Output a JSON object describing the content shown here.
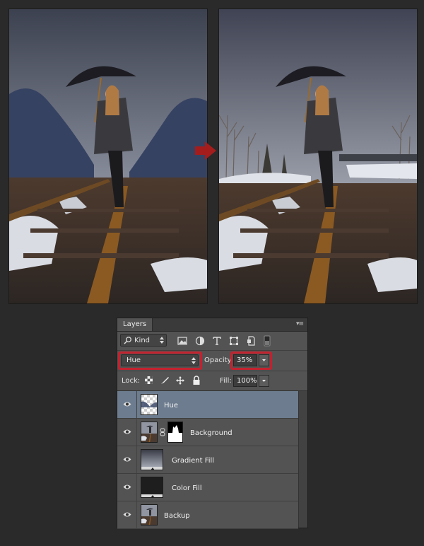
{
  "panel": {
    "tab_title": "Layers",
    "kind_filter": "Kind",
    "blend_mode": "Hue",
    "opacity_label": "Opacity:",
    "opacity_value": "35%",
    "lock_label": "Lock:",
    "fill_label": "Fill:",
    "fill_value": "100%"
  },
  "layers": [
    {
      "name": "Hue",
      "selected": true,
      "thumb": "transparent-checker",
      "visible": true
    },
    {
      "name": "Background",
      "selected": false,
      "thumb": "photo",
      "mask": "layer-mask",
      "visible": true
    },
    {
      "name": "Gradient Fill",
      "selected": false,
      "thumb": "gradient",
      "visible": true
    },
    {
      "name": "Color Fill",
      "selected": false,
      "thumb": "dark-fill",
      "visible": true
    },
    {
      "name": "Backup",
      "selected": false,
      "thumb": "photo",
      "visible": true
    }
  ],
  "colors": {
    "highlight": "#c3222f",
    "arrow": "#a51c1c",
    "selected_layer": "#6d7c8f",
    "panel_bg": "#535353"
  },
  "icons": [
    "search-icon",
    "image-filter-icon",
    "adjustment-filter-icon",
    "type-filter-icon",
    "shape-filter-icon",
    "smart-object-filter-icon",
    "filter-toggle-icon",
    "eye-icon",
    "link-icon",
    "panel-menu-icon"
  ]
}
